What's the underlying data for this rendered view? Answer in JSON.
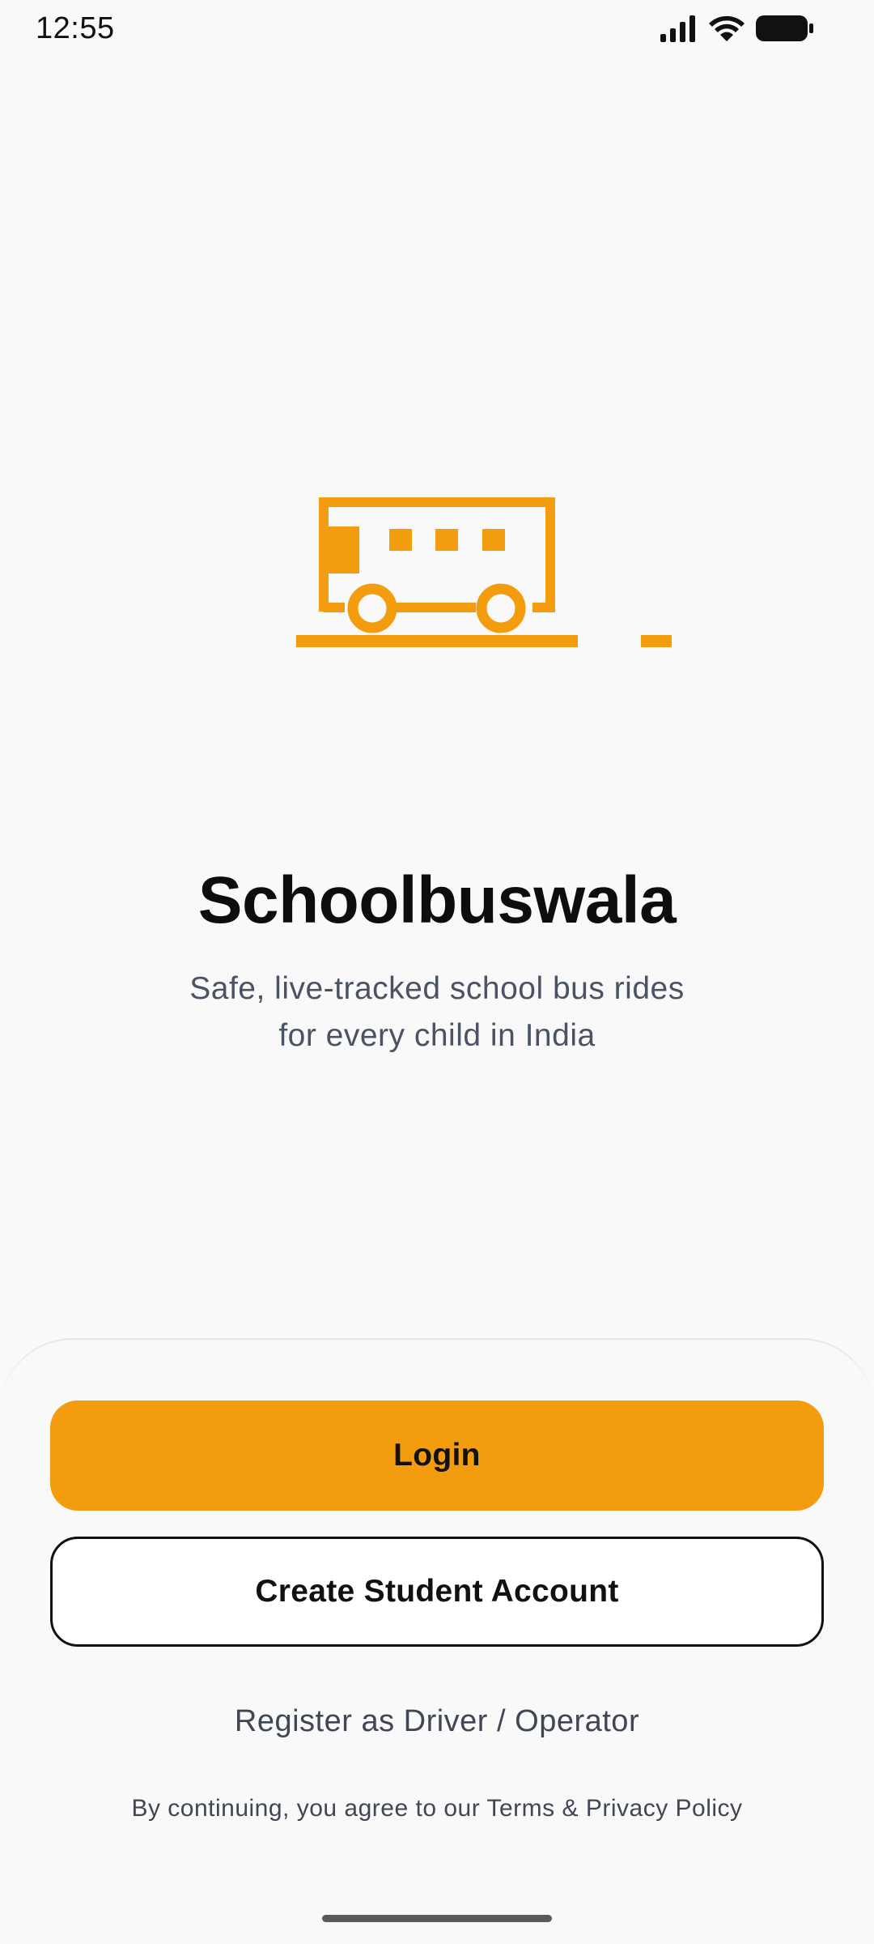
{
  "status_bar": {
    "time": "12:55",
    "icons": [
      "signal-icon",
      "wifi-icon",
      "battery-icon"
    ]
  },
  "hero": {
    "illustration": "school-bus-icon",
    "accent_color": "#f39c0e"
  },
  "app": {
    "title": "Schoolbuswala",
    "tagline_line1": "Safe, live-tracked school bus rides",
    "tagline_line2": "for every child in India"
  },
  "actions": {
    "login_label": "Login",
    "create_account_label": "Create Student Account",
    "register_label": "Register as Driver / Operator"
  },
  "legal": {
    "text": "By continuing, you agree to our Terms & Privacy Policy"
  },
  "colors": {
    "background": "#f9f9f9",
    "primary": "#f39c0e",
    "text": "#111111",
    "muted_text": "#4a5363"
  }
}
